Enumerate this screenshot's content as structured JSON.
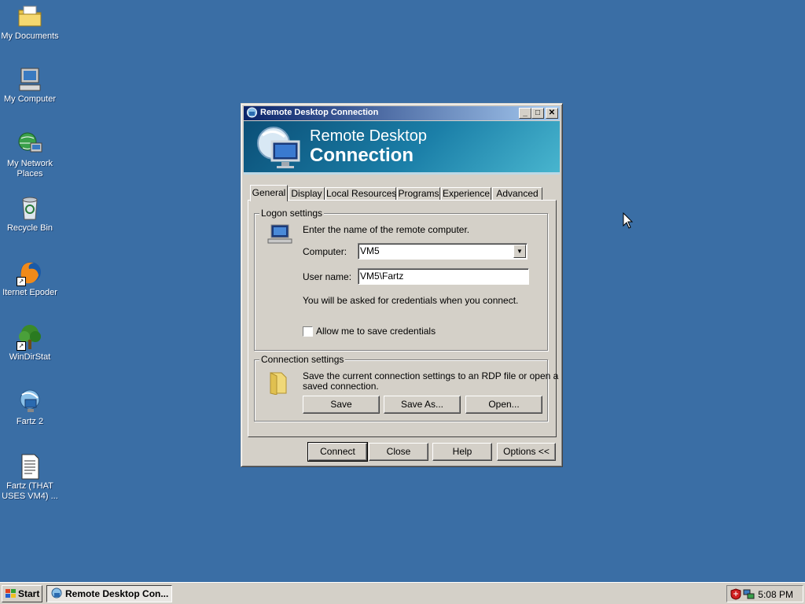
{
  "desktop": {
    "icons": [
      {
        "label": "My Documents",
        "icon": "folder-documents-icon"
      },
      {
        "label": "My Computer",
        "icon": "computer-icon"
      },
      {
        "label": "My Network Places",
        "icon": "network-places-icon"
      },
      {
        "label": "Recycle Bin",
        "icon": "recycle-bin-icon"
      },
      {
        "label": "Iternet Epoder",
        "icon": "firefox-icon"
      },
      {
        "label": "WinDirStat",
        "icon": "windirstat-tree-icon"
      },
      {
        "label": "Fartz 2",
        "icon": "remote-desktop-icon"
      },
      {
        "label": "Fartz (THAT USES VM4) ...",
        "icon": "rdp-file-icon"
      }
    ]
  },
  "window": {
    "title": "Remote Desktop Connection",
    "banner": {
      "line1": "Remote Desktop",
      "line2": "Connection"
    },
    "title_buttons": {
      "minimize": "_",
      "maximize": "□",
      "close": "✕"
    },
    "tabs": [
      {
        "label": "General",
        "active": true
      },
      {
        "label": "Display",
        "active": false
      },
      {
        "label": "Local Resources",
        "active": false
      },
      {
        "label": "Programs",
        "active": false
      },
      {
        "label": "Experience",
        "active": false
      },
      {
        "label": "Advanced",
        "active": false
      }
    ],
    "logon": {
      "group_title": "Logon settings",
      "intro": "Enter the name of the remote computer.",
      "computer_label": "Computer:",
      "computer_value": "VM5",
      "username_label": "User name:",
      "username_value": "VM5\\Fartz",
      "credentials_note": "You will be asked for credentials when you connect.",
      "save_credentials_label": "Allow me to save credentials",
      "save_credentials_checked": false
    },
    "connection": {
      "group_title": "Connection settings",
      "description_line1": "Save the current connection settings to an RDP file or open a",
      "description_line2": "saved connection.",
      "save_button": "Save",
      "save_as_button": "Save As...",
      "open_button": "Open..."
    },
    "buttons": {
      "connect": "Connect",
      "close": "Close",
      "help": "Help",
      "options": "Options <<"
    }
  },
  "taskbar": {
    "start_label": "Start",
    "task_label": "Remote Desktop Con...",
    "clock": "5:08 PM"
  },
  "colors": {
    "desktop": "#3a6ea5",
    "titlebar_start": "#0a246a",
    "titlebar_end": "#a6caf0",
    "face": "#d4d0c8"
  }
}
